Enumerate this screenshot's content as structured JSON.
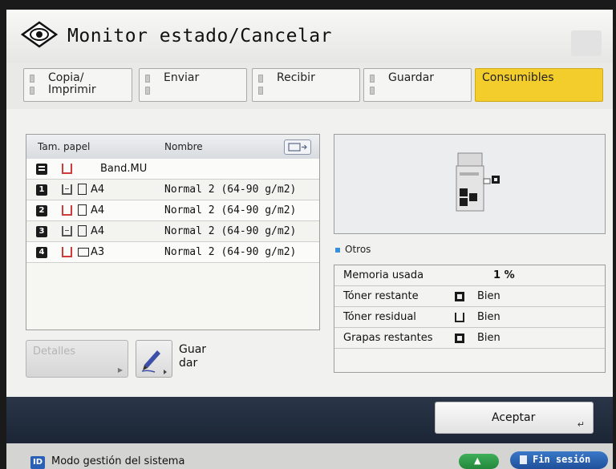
{
  "title": "Monitor estado/Cancelar",
  "tabs": [
    {
      "label": "Copia/\nImprimir",
      "active": false
    },
    {
      "label": "Enviar",
      "active": false
    },
    {
      "label": "Recibir",
      "active": false
    },
    {
      "label": "Guardar",
      "active": false
    },
    {
      "label": "Consumibles",
      "active": true
    }
  ],
  "paper_table": {
    "headers": {
      "size": "Tam. papel",
      "name": "Nombre"
    },
    "rows": [
      {
        "num": "",
        "size": "Band.MU",
        "name": ""
      },
      {
        "num": "1",
        "size": "A4",
        "name": "Normal 2 (64-90 g/m2)"
      },
      {
        "num": "2",
        "size": "A4",
        "name": "Normal 2 (64-90 g/m2)"
      },
      {
        "num": "3",
        "size": "A4",
        "name": "Normal 2 (64-90 g/m2)"
      },
      {
        "num": "4",
        "size": "A3",
        "name": "Normal 2 (64-90 g/m2)"
      }
    ]
  },
  "buttons": {
    "details": "Detalles",
    "save": "Guar\ndar",
    "accept": "Aceptar"
  },
  "otros": "Otros",
  "status": [
    {
      "label": "Memoria usada",
      "value": "1 %"
    },
    {
      "label": "Tóner restante",
      "value": "Bien"
    },
    {
      "label": "Tóner residual",
      "value": "Bien"
    },
    {
      "label": "Grapas restantes",
      "value": "Bien"
    }
  ],
  "footer": {
    "mode": "Modo gestión del sistema",
    "logout": "Fin sesión"
  },
  "colors": {
    "active_tab": "#f3cd2b",
    "bottom_bar": "#1f2a3b",
    "logout": "#2a5fb6"
  }
}
